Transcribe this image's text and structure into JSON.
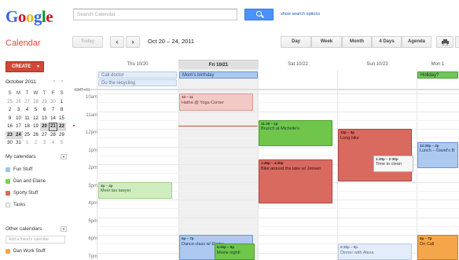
{
  "header": {
    "logo_letters": [
      {
        "ch": "G",
        "color": "#3369e8"
      },
      {
        "ch": "o",
        "color": "#d50f25"
      },
      {
        "ch": "o",
        "color": "#eeb211"
      },
      {
        "ch": "g",
        "color": "#3369e8"
      },
      {
        "ch": "l",
        "color": "#009925"
      },
      {
        "ch": "e",
        "color": "#d50f25"
      }
    ],
    "search_placeholder": "Search Calendar",
    "search_options_link": "show search options"
  },
  "toolbar": {
    "app_title": "Calendar",
    "today_label": "Today",
    "prev_label": "‹",
    "next_label": "›",
    "date_range": "Oct 20 – 24, 2011",
    "views": [
      "Day",
      "Week",
      "Month",
      "4 Days",
      "Agenda"
    ],
    "print_icon": "printer-icon",
    "settings_icon": "gear-icon"
  },
  "sidebar": {
    "create_label": "CREATE",
    "create_arrow": "▼",
    "mini_calendar": {
      "title": "October 2011",
      "prev": "‹",
      "next": "›",
      "dow": [
        "S",
        "M",
        "T",
        "W",
        "T",
        "F",
        "S"
      ],
      "weeks": [
        [
          "25",
          "26",
          "27",
          "28",
          "29",
          "30",
          "1"
        ],
        [
          "2",
          "3",
          "4",
          "5",
          "6",
          "7",
          "8"
        ],
        [
          "9",
          "10",
          "11",
          "12",
          "13",
          "14",
          "15"
        ],
        [
          "16",
          "17",
          "18",
          "19",
          "20",
          "21",
          "22"
        ],
        [
          "23",
          "24",
          "25",
          "26",
          "27",
          "28",
          "29"
        ],
        [
          "30",
          "31",
          "1",
          "2",
          "3",
          "4",
          "5"
        ]
      ]
    },
    "my_calendars_title": "My calendars",
    "my_calendars": [
      {
        "name": "Fun Stuff",
        "color": "#9fc6e7"
      },
      {
        "name": "Dan and Elaine",
        "color": "#7bd148"
      },
      {
        "name": "Sporty Stuff",
        "color": "#d96a60"
      },
      {
        "name": "Tasks",
        "color": ""
      }
    ],
    "other_calendars_title": "Other calendars",
    "friend_placeholder": "Add a friend's calendar",
    "other_calendars": [
      {
        "name": "Dan Work Stuff",
        "color": "#f6a64a"
      }
    ]
  },
  "week": {
    "days": [
      "Thu 10/20",
      "Fri 10/21",
      "Sat 10/22",
      "Sun 10/23",
      "Mon 1"
    ],
    "timezone": "GMT+01",
    "hours": [
      "10am",
      "11am",
      "12pm",
      "1pm",
      "2pm",
      "3pm",
      "4pm",
      "5pm",
      "6pm",
      "7pm"
    ],
    "allday_events": [
      {
        "day": 0,
        "row": 0,
        "title": "Call doctor",
        "style": "ev-blue-light"
      },
      {
        "day": 0,
        "row": 1,
        "title": "Do the recycling",
        "style": "ev-blue-light"
      },
      {
        "day": 1,
        "row": 0,
        "title": "Mom's birthday",
        "style": "ev-blue"
      },
      {
        "day": 4,
        "row": 0,
        "title": "Holiday?",
        "style": "ev-yellow-allday"
      }
    ],
    "events": [
      {
        "day": 1,
        "start": 10.0,
        "end": 11.0,
        "time": "10 – 11",
        "title": "Hatha @ Yoga Corner",
        "style": "ev-red-light"
      },
      {
        "day": 2,
        "start": 11.5,
        "end": 13.0,
        "time": "11:30 – 1p",
        "title": "Brunch at Michelle's",
        "style": "ev-green"
      },
      {
        "day": 2,
        "start": 13.75,
        "end": 16.25,
        "time": "1:45p – 4:30p",
        "title": "Bike around the lake w/ Jensen",
        "style": "ev-red"
      },
      {
        "day": 3,
        "start": 12.0,
        "end": 15.0,
        "time": "12p – 3p",
        "title": "Long hike",
        "style": "ev-red"
      },
      {
        "day": 3,
        "start": 13.5,
        "end": 14.5,
        "time": "1:30p – 2:30p",
        "title": "Time to clean",
        "style": "ev-white",
        "inset": true
      },
      {
        "day": 4,
        "start": 12.75,
        "end": 14.25,
        "time": "12:30p – 2p",
        "title": "Lunch – David's B",
        "style": "ev-blue"
      },
      {
        "day": 0,
        "start": 15.0,
        "end": 16.0,
        "time": "3p – 4p",
        "title": "Meet tax lawyer",
        "style": "ev-green-light"
      },
      {
        "day": 1,
        "start": 18.0,
        "end": 19.5,
        "time": "6p – 7p",
        "title": "Dance class w/ Elaine",
        "style": "ev-blue"
      },
      {
        "day": 1,
        "start": 18.5,
        "end": 19.5,
        "time": "6:30p – 9p",
        "title": "Movie night!",
        "style": "ev-green",
        "inset": true
      },
      {
        "day": 3,
        "start": 18.5,
        "end": 19.5,
        "time": "6:30p – 9p",
        "title": "Dinner with Alexa",
        "style": "ev-blue-light"
      },
      {
        "day": 4,
        "start": 18.0,
        "end": 19.5,
        "time": "6p – 7p",
        "title": "On Call",
        "style": "ev-orange"
      }
    ]
  },
  "colors": {
    "accent_red": "#dd4b39",
    "primary_blue": "#4d90fe"
  }
}
